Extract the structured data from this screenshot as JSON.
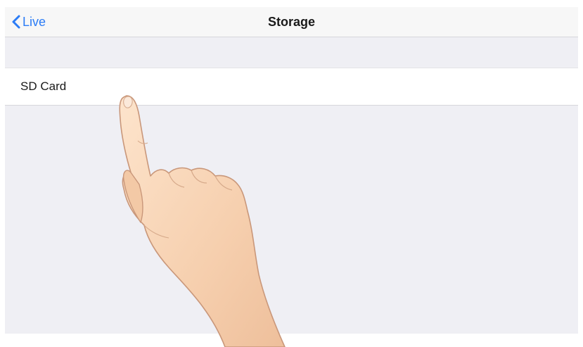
{
  "nav": {
    "back_label": "Live",
    "back_icon": "chevron-left-icon",
    "title": "Storage"
  },
  "list": {
    "items": [
      {
        "label": "SD Card"
      }
    ]
  },
  "colors": {
    "accent": "#2b7cf6",
    "background": "#efeff4",
    "nav_bar": "#f7f7f7",
    "row": "#ffffff"
  },
  "illustration": {
    "name": "pointing-hand-icon"
  }
}
